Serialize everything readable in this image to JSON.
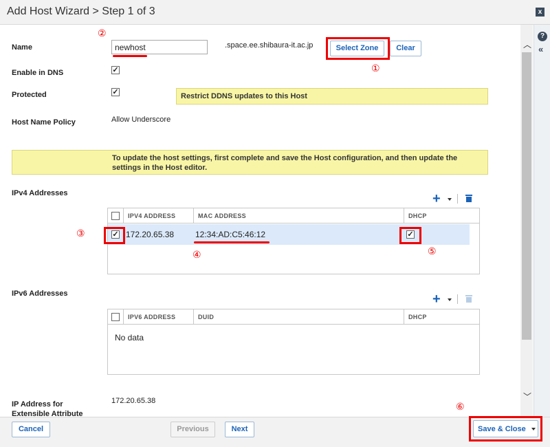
{
  "window": {
    "title": "Add Host Wizard > Step 1 of 3",
    "close_glyph": "x"
  },
  "form": {
    "name_label": "Name",
    "name_value": "newhost",
    "zone_suffix": ".space.ee.shibaura-it.ac.jp",
    "select_zone_label": "Select Zone",
    "clear_label": "Clear",
    "enable_dns_label": "Enable in DNS",
    "protected_label": "Protected",
    "protected_note": "Restrict DDNS updates to this Host",
    "host_name_policy_label": "Host Name Policy",
    "host_name_policy_value": "Allow Underscore",
    "info_note": "To update the host settings, first complete and save the Host configuration, and then update the settings in the Host editor.",
    "ip_ea_label": "IP Address for Extensible Attribute",
    "ip_ea_value": "172.20.65.38"
  },
  "ipv4": {
    "section_label": "IPv4 Addresses",
    "columns": [
      "IPV4 ADDRESS",
      "MAC ADDRESS",
      "DHCP"
    ],
    "rows": [
      {
        "ip": "172.20.65.38",
        "mac": "12:34:AD:C5:46:12",
        "checked": true,
        "dhcp": true
      }
    ]
  },
  "ipv6": {
    "section_label": "IPv6 Addresses",
    "columns": [
      "IPV6 ADDRESS",
      "DUID",
      "DHCP"
    ],
    "empty_text": "No data"
  },
  "annotations": [
    "①",
    "②",
    "③",
    "④",
    "⑤",
    "⑥"
  ],
  "footer": {
    "cancel_label": "Cancel",
    "previous_label": "Previous",
    "next_label": "Next",
    "save_close_label": "Save & Close"
  },
  "colors": {
    "accent": "#1a63b8",
    "highlight": "#e00000",
    "note_bg": "#f8f6a6",
    "selected_row": "#dbe9fa"
  },
  "icons": [
    "close-icon",
    "help-icon",
    "collapse-icon",
    "add-icon",
    "trash-icon",
    "scroll-up-icon",
    "scroll-down-icon",
    "dropdown-caret-icon"
  ]
}
